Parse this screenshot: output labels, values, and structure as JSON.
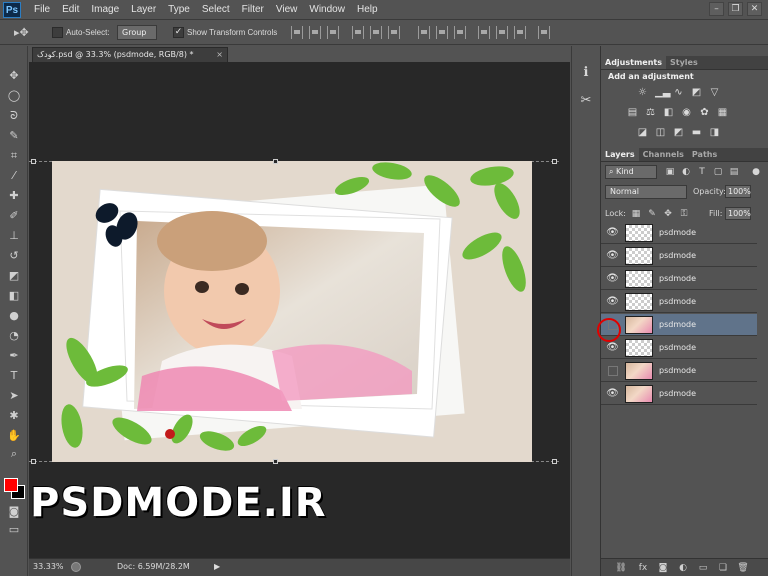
{
  "app": {
    "logo": "Ps"
  },
  "menu": [
    "File",
    "Edit",
    "Image",
    "Layer",
    "Type",
    "Select",
    "Filter",
    "View",
    "Window",
    "Help"
  ],
  "window_controls": {
    "minimize": "–",
    "restore": "❐",
    "close": "✕"
  },
  "options_bar": {
    "auto_select_label": "Auto-Select:",
    "auto_select_checked": false,
    "group_value": "Group",
    "show_transform_label": "Show Transform Controls",
    "show_transform_checked": true
  },
  "document": {
    "tab_title": "کودک.psd @ 33.3% (psdmode, RGB/8) *",
    "close_label": "×"
  },
  "status_bar": {
    "zoom": "33.33%",
    "doc_info": "Doc: 6.59M/28.2M"
  },
  "adjustments": {
    "tabs": [
      "Adjustments",
      "Styles"
    ],
    "active_tab": "Adjustments",
    "title": "Add an adjustment"
  },
  "layers_panel": {
    "tabs": [
      "Layers",
      "Channels",
      "Paths"
    ],
    "active_tab": "Layers",
    "filter_kind": "Kind",
    "blend_mode": "Normal",
    "opacity_label": "Opacity:",
    "opacity_value": "100%",
    "lock_label": "Lock:",
    "fill_label": "Fill:",
    "fill_value": "100%",
    "layers": [
      {
        "name": "psdmode",
        "visible": true,
        "thumb": "transparent",
        "selected": false
      },
      {
        "name": "psdmode",
        "visible": true,
        "thumb": "transparent",
        "selected": false
      },
      {
        "name": "psdmode",
        "visible": true,
        "thumb": "transparent",
        "selected": false
      },
      {
        "name": "psdmode",
        "visible": true,
        "thumb": "transparent",
        "selected": false
      },
      {
        "name": "psdmode",
        "visible": false,
        "thumb": "photo",
        "selected": true
      },
      {
        "name": "psdmode",
        "visible": true,
        "thumb": "transparent",
        "selected": false
      },
      {
        "name": "psdmode",
        "visible": false,
        "thumb": "photo",
        "selected": false
      },
      {
        "name": "psdmode",
        "visible": true,
        "thumb": "photo",
        "selected": false
      }
    ]
  },
  "watermark": "PSDMODE.IR",
  "colors": {
    "foreground": "#ff0000",
    "background": "#000000",
    "highlight_circle": "#e00000"
  }
}
